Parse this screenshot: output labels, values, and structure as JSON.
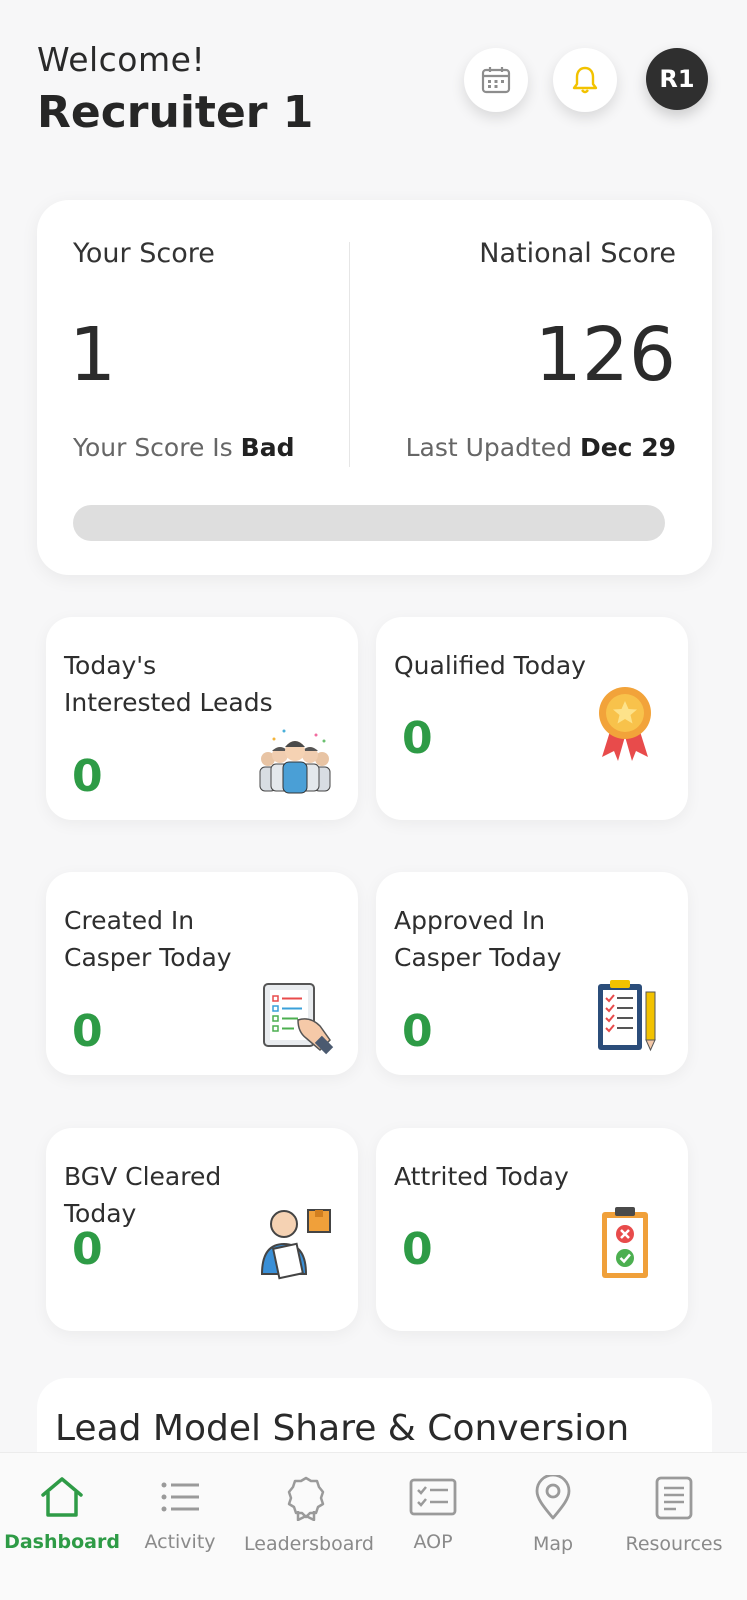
{
  "header": {
    "welcome": "Welcome!",
    "user_name": "Recruiter 1",
    "avatar_initials": "R1"
  },
  "score": {
    "your_label": "Your Score",
    "your_value": "1",
    "your_status_prefix": "Your Score Is",
    "your_status": "Bad",
    "national_label": "National Score",
    "national_value": "126",
    "updated_prefix": "Last Upadted",
    "updated_date": "Dec 29",
    "progress_fraction": 0
  },
  "stats": [
    {
      "label": "Today's Interested Leads",
      "value": "0",
      "icon": "team-icon"
    },
    {
      "label": "Qualified Today",
      "value": "0",
      "icon": "medal-icon"
    },
    {
      "label": "Created In Casper Today",
      "value": "0",
      "icon": "clipboard-hand-icon"
    },
    {
      "label": "Approved In Casper Today",
      "value": "0",
      "icon": "checklist-pen-icon"
    },
    {
      "label": "BGV Cleared Today",
      "value": "0",
      "icon": "verification-user-icon"
    },
    {
      "label": "Attrited Today",
      "value": "0",
      "icon": "clipboard-status-icon"
    }
  ],
  "lead_section": {
    "title": "Lead Model Share & Conversion"
  },
  "nav": [
    {
      "label": "Dashboard",
      "icon": "home-icon",
      "active": true
    },
    {
      "label": "Activity",
      "icon": "list-icon",
      "active": false
    },
    {
      "label": "Leadersboard",
      "icon": "badge-icon",
      "active": false
    },
    {
      "label": "AOP",
      "icon": "checklist-icon",
      "active": false
    },
    {
      "label": "Map",
      "icon": "map-pin-icon",
      "active": false
    },
    {
      "label": "Resources",
      "icon": "document-icon",
      "active": false
    }
  ],
  "colors": {
    "accent_green": "#2e9b46",
    "bell_yellow": "#f2c200",
    "avatar_bg": "#2f2f2f"
  }
}
